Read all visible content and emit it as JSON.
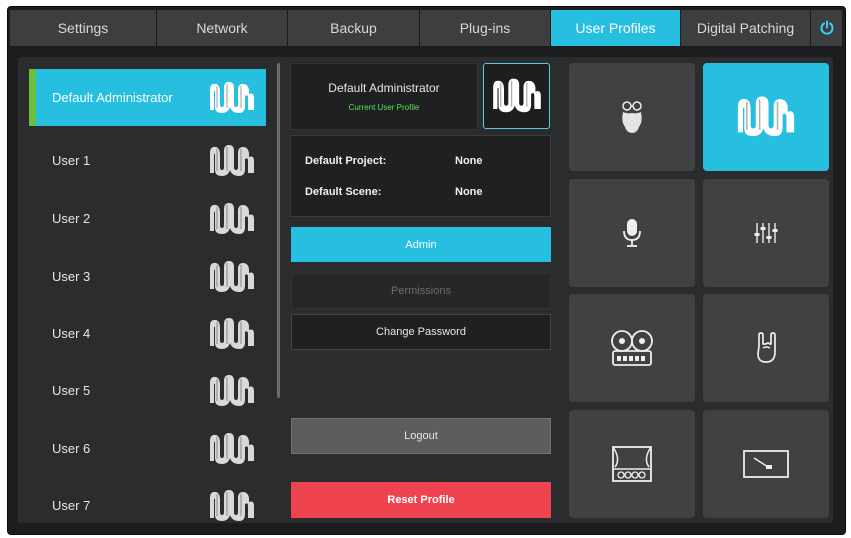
{
  "tabs": [
    {
      "label": "Settings",
      "active": false
    },
    {
      "label": "Network",
      "active": false
    },
    {
      "label": "Backup",
      "active": false
    },
    {
      "label": "Plug-ins",
      "active": false
    },
    {
      "label": "User Profiles",
      "active": true
    },
    {
      "label": "Digital Patching",
      "active": false
    }
  ],
  "power_icon": "power-icon",
  "users": [
    {
      "name": "Default Administrator",
      "selected": true,
      "icon": "presonus-logo-icon"
    },
    {
      "name": "User 1",
      "icon": "presonus-logo-icon"
    },
    {
      "name": "User 2",
      "icon": "presonus-logo-icon"
    },
    {
      "name": "User 3",
      "icon": "presonus-logo-icon"
    },
    {
      "name": "User 4",
      "icon": "presonus-logo-icon"
    },
    {
      "name": "User 5",
      "icon": "presonus-logo-icon"
    },
    {
      "name": "User 6",
      "icon": "presonus-logo-icon"
    },
    {
      "name": "User 7",
      "icon": "presonus-logo-icon"
    }
  ],
  "profile": {
    "name": "Default Administrator",
    "subtitle": "Current User Profile",
    "default_project_label": "Default Project:",
    "default_project_value": "None",
    "default_scene_label": "Default Scene:",
    "default_scene_value": "None"
  },
  "buttons": {
    "admin": "Admin",
    "permissions": "Permissions",
    "change_password": "Change Password",
    "logout": "Logout",
    "reset": "Reset Profile"
  },
  "icon_tiles": [
    {
      "icon": "bearded-face-icon",
      "selected": false
    },
    {
      "icon": "presonus-logo-icon",
      "selected": true
    },
    {
      "icon": "microphone-icon",
      "selected": false
    },
    {
      "icon": "faders-icon",
      "selected": false
    },
    {
      "icon": "reel-to-reel-icon",
      "selected": false
    },
    {
      "icon": "rock-hand-icon",
      "selected": false
    },
    {
      "icon": "stage-icon",
      "selected": false
    },
    {
      "icon": "turntable-icon",
      "selected": false
    }
  ],
  "colors": {
    "accent": "#26bfe0",
    "selected_marker": "#6cbf3c",
    "current_profile_text": "#5be05b",
    "reset": "#ef4450"
  }
}
